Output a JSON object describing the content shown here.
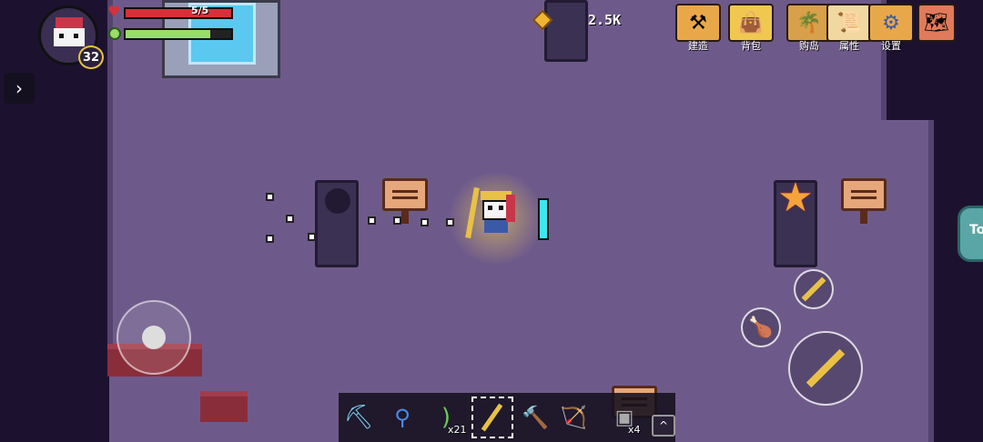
{
  "hud": {
    "hp_text": "5/5",
    "hp_fraction": 1.0,
    "mp_fraction": 0.8,
    "level": "32",
    "coins": "2.5K"
  },
  "menu": [
    {
      "id": "build",
      "label": "建造",
      "icon": "anvil-icon"
    },
    {
      "id": "bag",
      "label": "背包",
      "icon": "bag-icon"
    },
    {
      "id": "shop",
      "label": "购岛",
      "icon": "island-icon"
    },
    {
      "id": "attributes",
      "label": "属性",
      "icon": "scroll-character-icon"
    },
    {
      "id": "settings",
      "label": "设置",
      "icon": "gear-icon"
    },
    {
      "id": "map",
      "label": "",
      "icon": "map-icon"
    }
  ],
  "right_tab_text": "To",
  "toolbar": {
    "items": [
      {
        "icon": "pickaxe-icon",
        "count": ""
      },
      {
        "icon": "shovel-icon",
        "count": ""
      },
      {
        "icon": "bow-icon",
        "count": "x21"
      },
      {
        "icon": "golden-spear-icon",
        "count": ""
      },
      {
        "icon": "hammer-icon",
        "count": ""
      },
      {
        "icon": "crossbow-icon",
        "count": ""
      },
      {
        "icon": "chest-icon",
        "count": "x4"
      }
    ],
    "expand": "^"
  },
  "colors": {
    "floor": "#6e5a8a",
    "hp": "#d6313a",
    "mp": "#98dd6a",
    "gold": "#f0b530"
  }
}
